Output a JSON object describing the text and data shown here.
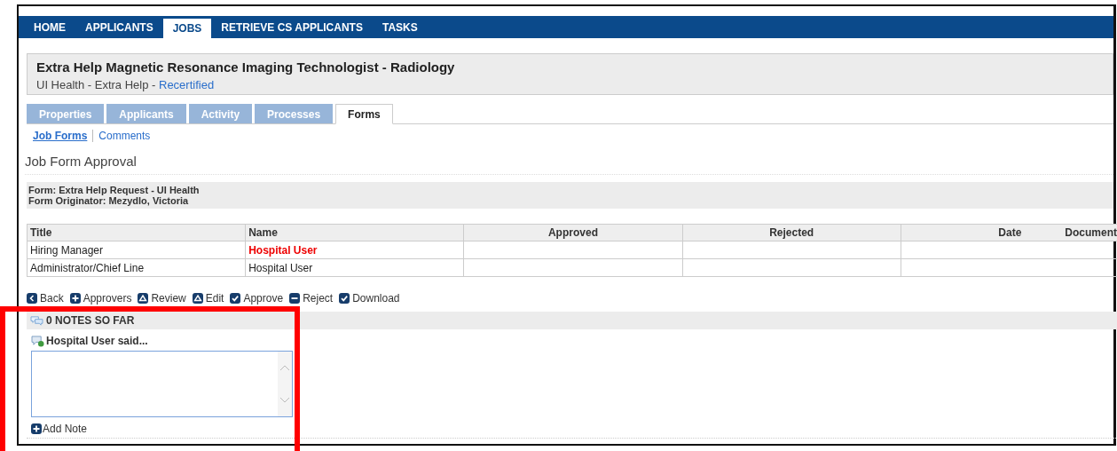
{
  "nav": [
    {
      "label": "HOME",
      "selected": false
    },
    {
      "label": "APPLICANTS",
      "selected": false
    },
    {
      "label": "JOBS",
      "selected": true
    },
    {
      "label": "RETRIEVE CS APPLICANTS",
      "selected": false
    },
    {
      "label": "TASKS",
      "selected": false
    }
  ],
  "job": {
    "title": "Extra Help Magnetic Resonance Imaging Technologist - Radiology",
    "subtitle": "UI Health - Extra Help - ",
    "status": "Recertified"
  },
  "tabs": [
    {
      "label": "Properties",
      "selected": false
    },
    {
      "label": "Applicants",
      "selected": false
    },
    {
      "label": "Activity",
      "selected": false
    },
    {
      "label": "Processes",
      "selected": false
    },
    {
      "label": "Forms",
      "selected": true
    }
  ],
  "sub_links": [
    {
      "label": "Job Forms",
      "selected": true
    },
    {
      "label": "Comments",
      "selected": false
    }
  ],
  "section_title": "Job Form Approval",
  "form_info": [
    "Form: Extra Help Request - UI Health",
    "Form Originator: Mezydlo, Victoria"
  ],
  "table": {
    "columns": [
      "Title",
      "Name",
      "Approved",
      "Rejected",
      "Date",
      "Document"
    ],
    "rows": [
      {
        "title": "Hiring Manager",
        "name": "Hospital User",
        "current": true
      },
      {
        "title": "Administrator/Chief Line",
        "name": "Hospital User",
        "current": false
      }
    ]
  },
  "actions": [
    {
      "label": "Back",
      "kind": "back"
    },
    {
      "label": "Approvers",
      "kind": "add"
    },
    {
      "label": "Review",
      "kind": "review"
    },
    {
      "label": "Edit",
      "kind": "edit"
    },
    {
      "label": "Approve",
      "kind": "approve"
    },
    {
      "label": "Reject",
      "kind": "reject"
    },
    {
      "label": "Download",
      "kind": "download"
    }
  ],
  "notes": {
    "header": "0 NOTES SO FAR",
    "author_label": "Hospital User said...",
    "add_label": "Add Note"
  },
  "highlight_frame": true
}
